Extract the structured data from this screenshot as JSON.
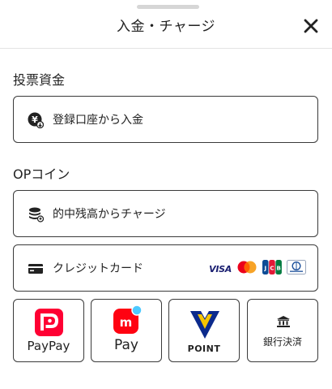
{
  "header": {
    "title": "入金・チャージ",
    "close_icon": "close-icon"
  },
  "betting": {
    "label": "投票資金",
    "deposit": {
      "label": "登録口座から入金",
      "icon": "yen-coin-icon"
    }
  },
  "op_coin": {
    "label": "OPコイン",
    "balance_charge": {
      "label": "的中残高からチャージ",
      "icon": "coin-stack-icon"
    },
    "credit_card": {
      "label": "クレジットカード",
      "icon": "credit-card-icon",
      "brands": [
        {
          "name": "visa-logo",
          "text": "VISA"
        },
        {
          "name": "mastercard-logo"
        },
        {
          "name": "jcb-logo"
        },
        {
          "name": "diners-club-logo"
        }
      ]
    }
  },
  "tiles": [
    {
      "id": "paypay",
      "label": "PayPay",
      "icon": "paypay-icon"
    },
    {
      "id": "merpay",
      "label": "Pay",
      "icon": "merpay-icon"
    },
    {
      "id": "vpoint",
      "label": "POINT",
      "icon": "v-point-icon"
    },
    {
      "id": "bank",
      "label": "銀行決済",
      "icon": "bank-icon"
    }
  ],
  "colors": {
    "paypay_red": "#ff0033",
    "merpay_red": "#ff0211",
    "vpoint_blue": "#0b2a8c",
    "vpoint_yellow": "#f6c400"
  }
}
